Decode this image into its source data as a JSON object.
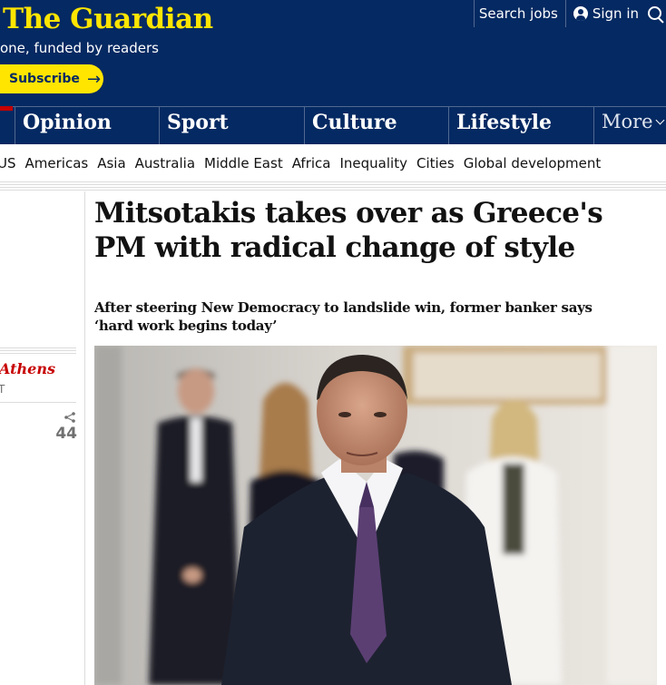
{
  "header": {
    "logo": "The Guardian",
    "tagline": "one, funded by readers",
    "subscribe_label": "Subscribe",
    "search_jobs": "Search jobs",
    "sign_in": "Sign in",
    "icons": [
      "person-icon",
      "search-icon",
      "arrow-right-icon"
    ],
    "colors": {
      "brand_blue": "#052962",
      "brand_yellow": "#ffe500",
      "news_red": "#c70000"
    }
  },
  "pillars": {
    "items": [
      "Opinion",
      "Sport",
      "Culture",
      "Lifestyle"
    ],
    "more": "More"
  },
  "subnav": {
    "items": [
      "US",
      "Americas",
      "Asia",
      "Australia",
      "Middle East",
      "Africa",
      "Inequality",
      "Cities",
      "Global development"
    ]
  },
  "meta": {
    "byline": "Athens",
    "dateline": "T",
    "share_count": "44"
  },
  "article": {
    "headline": "Mitsotakis takes over as Greece's PM with radical change of style",
    "standfirst": "After steering New Democracy to landslide win, former banker says ‘hard work begins today’"
  }
}
